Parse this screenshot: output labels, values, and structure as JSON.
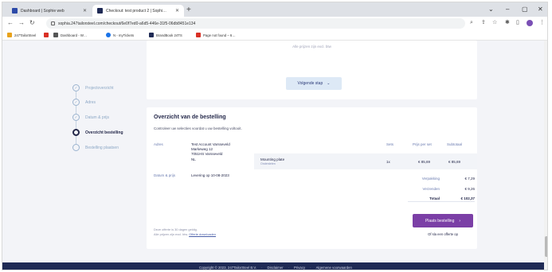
{
  "browser": {
    "tabs": [
      {
        "label": "Dashboard | Sophie web",
        "active": false,
        "favicon_color": "#2d4aa8"
      },
      {
        "label": "Checkout: test product 2 | Sophi…",
        "active": true,
        "favicon_color": "#1f2a55"
      }
    ],
    "url": "sophia.247tailorsteel.com/checkout/6e0f7ed0-a6d5-446e-31f5-06db8451e134",
    "bookmarks": [
      {
        "label": "247TailorSteel",
        "icon_color": "#e8a21a"
      },
      {
        "label": "",
        "icon_color": "#d93025"
      },
      {
        "label": "Dashboard - W…",
        "icon_color": "#555555"
      },
      {
        "label": "N - myTickets",
        "icon_color": "#1a73e8"
      },
      {
        "label": "BrandBook 24TS",
        "icon_color": "#1f2a55"
      },
      {
        "label": "Page not found – 6…",
        "icon_color": "#d93025"
      }
    ]
  },
  "page": {
    "vat_note": "Alle prijzen zijn excl. btw",
    "next_step_label": "Volgende stap",
    "steps": [
      {
        "label": "Projectoverzicht",
        "state": "done"
      },
      {
        "label": "Adres",
        "state": "done"
      },
      {
        "label": "Datum & prijs",
        "state": "done"
      },
      {
        "label": "Overzicht bestelling",
        "state": "current"
      },
      {
        "label": "Bestelling plaatsen",
        "state": "todo"
      }
    ],
    "overview": {
      "title": "Overzicht van de bestelling",
      "subtitle": "Controleer uw selecties voordat u uw bestelling voltooit.",
      "address_label": "Adres",
      "address_lines": [
        "Test Account Varsseveld",
        "Markeweg 12",
        "7051HS Varsseveld",
        "NL"
      ],
      "date_label": "Datum & prijs",
      "date_value": "Levering op 10-08-2023",
      "columns": {
        "sets": "Sets",
        "price_per_set": "Prijs per set",
        "subtotal": "Subtotaal"
      },
      "product": {
        "name": "Mounting plate",
        "category": "Onderdelen",
        "sets": "1x",
        "price_per_set": "€ 85,69",
        "subtotal": "€ 85,69"
      },
      "totals": [
        {
          "label": "Verpakking",
          "value": "€ 7,29"
        },
        {
          "label": "Verzenden",
          "value": "€ 9,26"
        },
        {
          "label": "Totaal",
          "value": "€ 102,37"
        }
      ],
      "place_order_label": "Plaats bestelling",
      "alt_link": "Of sla een offerte op",
      "note_line1": "Deze offerte is 30 dagen geldig.",
      "note_line2_prefix": "Alle prijzen zijn excl. btw.",
      "note_link": "Offerte downloaden"
    },
    "footer": {
      "copyright": "Copyright © 2023, 247TailorSteel B.V.",
      "links": [
        "Disclaimer",
        "Privacy",
        "Algemene voorwaarden"
      ]
    }
  },
  "colors": {
    "brand_navy": "#1f2a55",
    "cta_purple": "#7b3fa6",
    "next_button_bg": "#dde9f6",
    "page_bg": "#f3f4f8"
  }
}
